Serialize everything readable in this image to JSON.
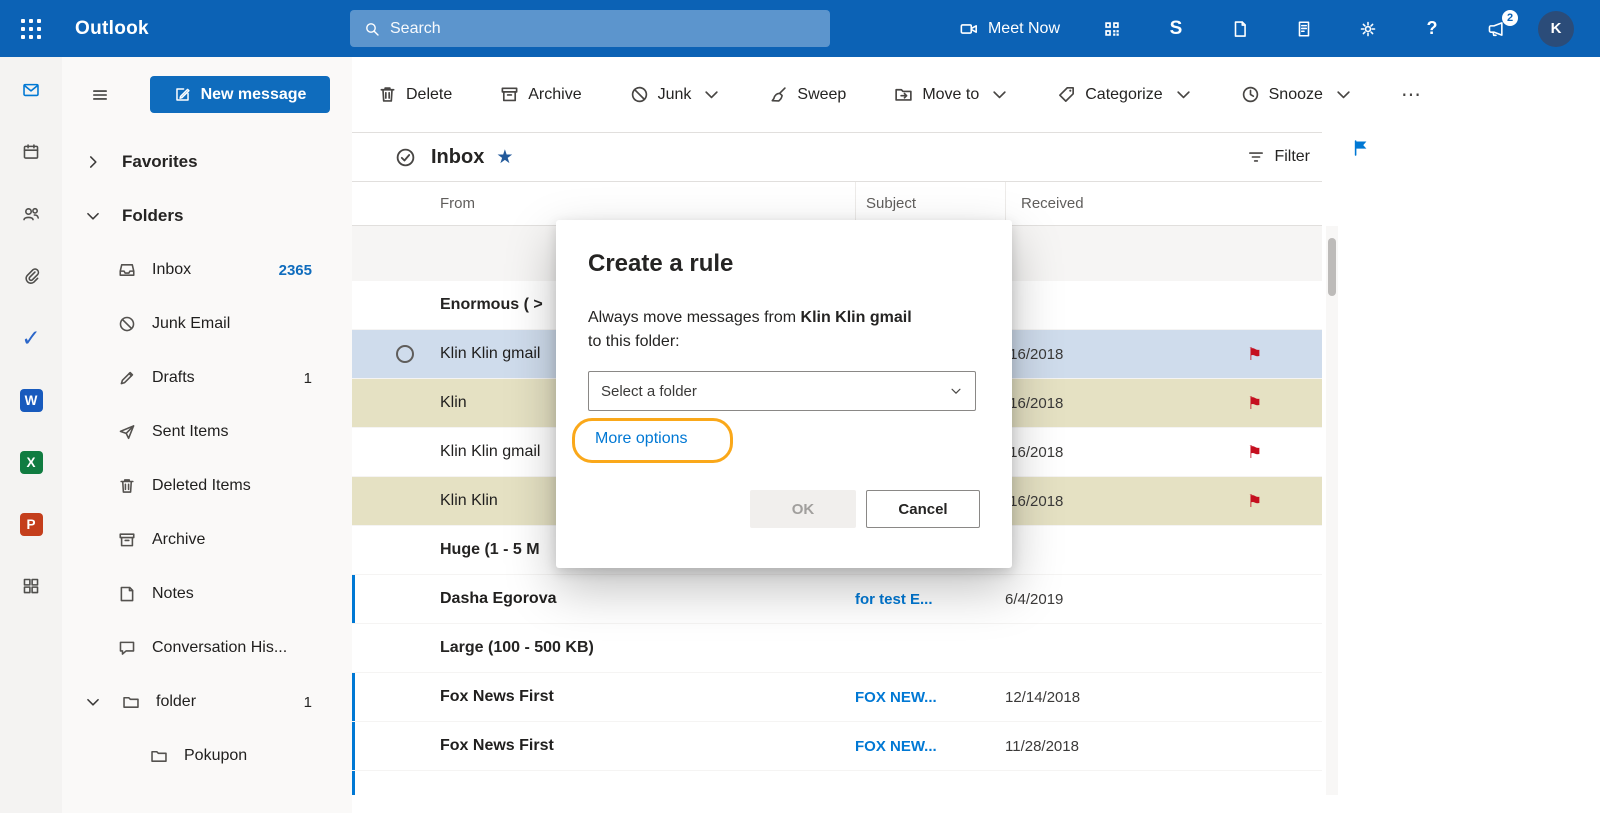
{
  "colors": {
    "brand": "#0c62b5",
    "accent": "#0078d4",
    "avatar": "#2b4c79",
    "selected_row": "#cfdcec",
    "flagged_row": "#e5e1c3",
    "flag_red": "#c50f1f",
    "highlight": "#faa81a"
  },
  "icons": {
    "star": "★",
    "flag": "⚑",
    "more": "⋯",
    "todo_check": "✓",
    "help": "?"
  },
  "topbar": {
    "app_name": "Outlook",
    "search_placeholder": "Search",
    "meet_now_label": "Meet Now",
    "skype_letter": "S",
    "notification_count": "2",
    "avatar_initial": "K"
  },
  "rail": {
    "word_letter": "W",
    "excel_letter": "X",
    "powerpoint_letter": "P"
  },
  "sidebar": {
    "new_message_label": "New message",
    "favorites_label": "Favorites",
    "folders_label": "Folders",
    "folders": [
      {
        "label": "Inbox",
        "count": "2365"
      },
      {
        "label": "Junk Email"
      },
      {
        "label": "Drafts",
        "count": "1"
      },
      {
        "label": "Sent Items"
      },
      {
        "label": "Deleted Items"
      },
      {
        "label": "Archive"
      },
      {
        "label": "Notes"
      },
      {
        "label": "Conversation His..."
      },
      {
        "label": "folder",
        "count": "1"
      },
      {
        "label": "Pokupon"
      }
    ]
  },
  "toolbar": {
    "items": [
      {
        "label": "Delete"
      },
      {
        "label": "Archive"
      },
      {
        "label": "Junk"
      },
      {
        "label": "Sweep"
      },
      {
        "label": "Move to"
      },
      {
        "label": "Categorize"
      },
      {
        "label": "Snooze"
      }
    ]
  },
  "list": {
    "title": "Inbox",
    "filter_label": "Filter",
    "columns": {
      "from": "From",
      "subject": "Subject",
      "received": "Received"
    },
    "rows": [
      {
        "type": "group",
        "label": "Enormous ( >"
      },
      {
        "type": "message",
        "from": "Klin Klin gmail",
        "subject": "",
        "received": "/16/2018"
      },
      {
        "type": "message",
        "from": "Klin",
        "subject": "",
        "received": "/16/2018"
      },
      {
        "type": "message",
        "from": "Klin Klin gmail",
        "subject": "",
        "received": "/16/2018"
      },
      {
        "type": "message",
        "from": "Klin Klin",
        "subject": "",
        "received": "/16/2018"
      },
      {
        "type": "group",
        "label": "Huge (1 - 5 M"
      },
      {
        "type": "message",
        "from": "Dasha Egorova",
        "subject": "for test E...",
        "received": "6/4/2019"
      },
      {
        "type": "group",
        "label": "Large (100 - 500 KB)"
      },
      {
        "type": "message",
        "from": "Fox News First",
        "subject": "FOX NEW...",
        "received": "12/14/2018"
      },
      {
        "type": "message",
        "from": "Fox News First",
        "subject": "FOX NEW...",
        "received": "11/28/2018"
      }
    ]
  },
  "dialog": {
    "title": "Create a rule",
    "body_prefix": "Always move messages from ",
    "sender": "Klin Klin gmail",
    "body_suffix": "to this folder:",
    "select_placeholder": "Select a folder",
    "more_options_label": "More options",
    "ok_label": "OK",
    "cancel_label": "Cancel"
  }
}
